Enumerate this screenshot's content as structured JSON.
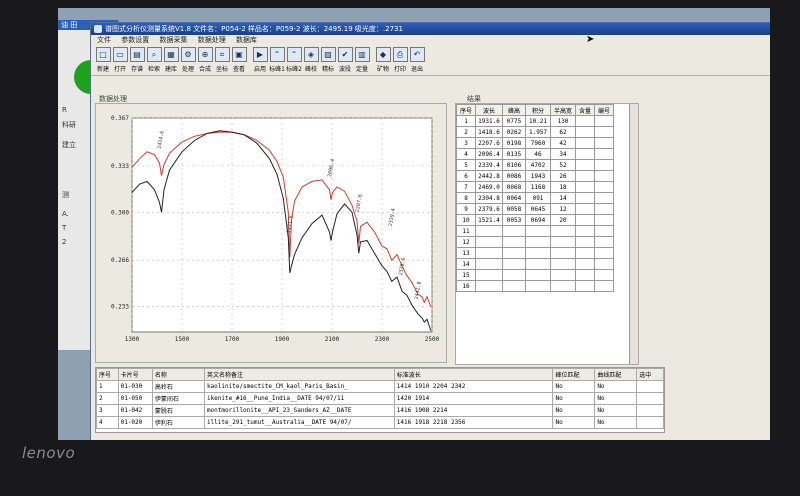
{
  "laptop_brand": "lenovo",
  "background_window": {
    "title": "油 田",
    "labels": [
      "R",
      "科研",
      "建立",
      "测",
      "A.",
      "T",
      "2"
    ]
  },
  "app": {
    "title": "谱图式分析仪测量系统V1.8  文件名：P054-2  样品名：P059-2  波长：2495.19  吸光度：.2731",
    "menu": [
      "文件",
      "参数设置",
      "数据采集",
      "数据处理",
      "数据库"
    ],
    "toolbar": [
      {
        "label": "新建",
        "icon": "new-icon"
      },
      {
        "label": "打开",
        "icon": "open-icon"
      },
      {
        "label": "存谱",
        "icon": "save-spectrum-icon"
      },
      {
        "label": "检索",
        "icon": "search-icon"
      },
      {
        "label": "建库",
        "icon": "build-library-icon"
      },
      {
        "label": "处理",
        "icon": "process-icon"
      },
      {
        "label": "合成",
        "icon": "merge-icon"
      },
      {
        "label": "坐标",
        "icon": "axis-icon"
      },
      {
        "label": "查看",
        "icon": "view-icon"
      },
      {
        "label": "启用",
        "icon": "enable-icon"
      },
      {
        "label": "标峰1",
        "icon": "peak-1-icon"
      },
      {
        "label": "标峰2",
        "icon": "peak-2-icon"
      },
      {
        "label": "峰校",
        "icon": "peak-calibrate-icon"
      },
      {
        "label": "精标",
        "icon": "fine-label-icon"
      },
      {
        "label": "波段",
        "icon": "band-icon"
      },
      {
        "label": "定量",
        "icon": "quantify-icon"
      },
      {
        "label": "矿物",
        "icon": "mineral-icon"
      },
      {
        "label": "打印",
        "icon": "print-icon"
      },
      {
        "label": "退出",
        "icon": "exit-icon"
      }
    ],
    "graph_panel_title": "数据处理",
    "result_panel_title": "结果",
    "result_headers": [
      "序号",
      "波长",
      "峰高",
      "积分",
      "半高宽",
      "含量",
      "编号"
    ],
    "results": [
      [
        "1",
        "1931.6",
        "0775",
        "10.21",
        "130"
      ],
      [
        "2",
        "1418.6",
        "0262",
        "1.957",
        "62"
      ],
      [
        "3",
        "2207.6",
        "0198",
        "7960",
        "42"
      ],
      [
        "4",
        "2096.4",
        "0135",
        "46",
        "34"
      ],
      [
        "5",
        "2339.4",
        "0106",
        "4702",
        "52"
      ],
      [
        "6",
        "2442.8",
        "0086",
        "1943",
        "26"
      ],
      [
        "7",
        "2469.0",
        "0068",
        "1168",
        "18"
      ],
      [
        "8",
        "2304.8",
        "0064",
        "091",
        "14"
      ],
      [
        "9",
        "2379.6",
        "0058",
        "0645",
        "12"
      ],
      [
        "10",
        "1521.4",
        "0053",
        "0694",
        "20"
      ],
      [
        "11",
        "",
        "",
        "",
        ""
      ],
      [
        "12",
        "",
        "",
        "",
        ""
      ],
      [
        "13",
        "",
        "",
        "",
        ""
      ],
      [
        "14",
        "",
        "",
        "",
        ""
      ],
      [
        "15",
        "",
        "",
        "",
        ""
      ],
      [
        "16",
        "",
        "",
        "",
        ""
      ]
    ],
    "match_headers": [
      "序号",
      "卡片号",
      "名称",
      "英文名称备注",
      "标准波长",
      "峰位匹配",
      "曲线匹配",
      "选中"
    ],
    "matches": [
      [
        "1",
        "01-030",
        "高岭石",
        "kaolinite/smectite_CM_kaol_Paris_Basin_",
        "1414  1910  2204  2342",
        "No",
        "No"
      ],
      [
        "2",
        "01-050",
        "伊蒙间石",
        "ikenite_#16__Pune_India__DATE 94/07/11",
        "1420  1914",
        "No",
        "No"
      ],
      [
        "3",
        "01-042",
        "蒙脱石",
        "montmorillonite__API_23_Sanders_AZ__DATE",
        "1416  1908  2214",
        "No",
        "No"
      ],
      [
        "4",
        "01-020",
        "伊利石",
        "illite_291_tumut__Australia__DATE 94/07/",
        "1416  1918  2218  2356",
        "No",
        "No"
      ]
    ]
  },
  "chart_data": {
    "type": "line",
    "xlim": [
      1300,
      2500
    ],
    "ylim": [
      0.215,
      0.367
    ],
    "xticks": [
      1300,
      1500,
      1700,
      1900,
      2100,
      2300,
      2500
    ],
    "yticks": [
      "0.367",
      "0.333",
      "0.300",
      "0.266",
      "0.233"
    ],
    "series": [
      {
        "color": "#d03a2c",
        "x": [
          1300,
          1330,
          1360,
          1390,
          1410,
          1418,
          1428,
          1450,
          1500,
          1550,
          1600,
          1650,
          1700,
          1750,
          1800,
          1850,
          1880,
          1905,
          1925,
          1931,
          1938,
          1950,
          1980,
          2020,
          2060,
          2090,
          2096,
          2102,
          2120,
          2150,
          2180,
          2200,
          2207,
          2214,
          2240,
          2270,
          2300,
          2320,
          2339,
          2360,
          2380,
          2400,
          2420,
          2443,
          2460,
          2469,
          2480,
          2495
        ],
        "y": [
          0.332,
          0.338,
          0.343,
          0.341,
          0.335,
          0.326,
          0.334,
          0.342,
          0.35,
          0.354,
          0.356,
          0.357,
          0.357,
          0.355,
          0.351,
          0.344,
          0.336,
          0.325,
          0.3,
          0.268,
          0.294,
          0.308,
          0.318,
          0.322,
          0.323,
          0.316,
          0.309,
          0.314,
          0.318,
          0.315,
          0.305,
          0.294,
          0.278,
          0.29,
          0.293,
          0.286,
          0.276,
          0.274,
          0.266,
          0.27,
          0.262,
          0.255,
          0.25,
          0.242,
          0.24,
          0.236,
          0.24,
          0.233
        ]
      },
      {
        "color": "#222222",
        "x": [
          1300,
          1330,
          1360,
          1390,
          1410,
          1418,
          1428,
          1450,
          1500,
          1550,
          1600,
          1650,
          1700,
          1750,
          1800,
          1850,
          1880,
          1905,
          1925,
          1931,
          1938,
          1950,
          1980,
          2020,
          2060,
          2090,
          2096,
          2102,
          2120,
          2150,
          2180,
          2200,
          2207,
          2214,
          2240,
          2270,
          2300,
          2320,
          2339,
          2360,
          2380,
          2400,
          2420,
          2443,
          2460,
          2469,
          2480,
          2495
        ],
        "y": [
          0.314,
          0.32,
          0.322,
          0.316,
          0.307,
          0.3,
          0.316,
          0.33,
          0.343,
          0.351,
          0.356,
          0.358,
          0.357,
          0.355,
          0.349,
          0.338,
          0.327,
          0.31,
          0.282,
          0.257,
          0.262,
          0.27,
          0.282,
          0.292,
          0.298,
          0.286,
          0.28,
          0.286,
          0.299,
          0.306,
          0.3,
          0.284,
          0.271,
          0.279,
          0.28,
          0.271,
          0.262,
          0.258,
          0.251,
          0.254,
          0.244,
          0.241,
          0.234,
          0.228,
          0.225,
          0.222,
          0.224,
          0.216
        ]
      }
    ],
    "peak_labels": [
      "1414.6",
      "1931.6",
      "2096.4",
      "2207.6",
      "2339.4",
      "2379.6",
      "2442.8"
    ]
  }
}
